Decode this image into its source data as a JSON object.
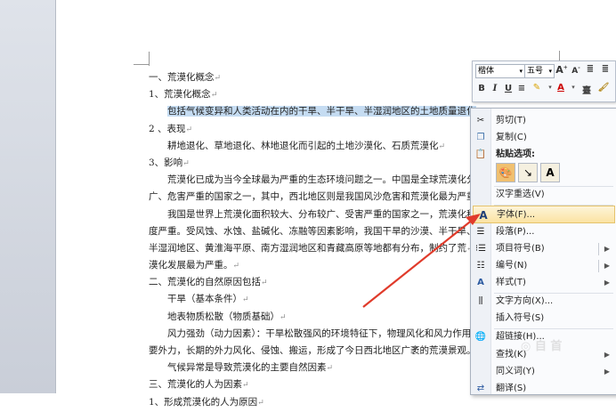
{
  "document": {
    "lines": [
      {
        "text": "一、荒漠化概念"
      },
      {
        "text": "1、荒漠化概念"
      },
      {
        "text": "包括气候变异和人类活动在内的干旱、半干旱、半湿润地区的土地质量退化",
        "highlight": true,
        "indent": true
      },
      {
        "text": "2 、表现"
      },
      {
        "text": "耕地退化、草地退化、林地退化而引起的土地沙漠化、石质荒漠化",
        "indent": true
      },
      {
        "text": "3、影响"
      },
      {
        "text": "荒漠化已成为当今全球最为严重的生态环境问题之一。中国是全球荒漠化分布",
        "indent": true
      },
      {
        "text": "广、危害严重的国家之一，其中，西北地区则是我国风沙危害和荒漠化最为严重的地区。"
      },
      {
        "text": "我国是世界上荒漠化面积较大、分布较广、受害严重的国家之一，荒漠化程",
        "indent": true
      },
      {
        "text": "度严重。受风蚀、水蚀、盐碱化、冻融等因素影响，我国干旱的沙漠、半干旱、"
      },
      {
        "text": "半湿润地区、黄淮海平原、南方湿润地区和青藏高原等地都有分布，制约了荒"
      },
      {
        "text": "漠化发展最为严重。"
      },
      {
        "text": "二、荒漠化的自然原因包括"
      },
      {
        "text": "干旱（基本条件）",
        "indent": true
      },
      {
        "text": "地表物质松散（物质基础）",
        "indent": true
      },
      {
        "text": "风力强劲（动力因素）：干旱松散强风的环境特征下，物理风化和风力作用主",
        "indent": true
      },
      {
        "text": "要外力，长期的外力风化、侵蚀、搬运，形成了今日西北地区广袤的荒漠景观。"
      },
      {
        "text": "气候异常是导致荒漠化的主要自然因素",
        "indent": true
      },
      {
        "text": "三、荒漠化的人为因素"
      },
      {
        "text": "1、形成荒漠化的人为原因"
      }
    ]
  },
  "mini_toolbar": {
    "font": "楷体",
    "size": "五号",
    "grow": "A",
    "shrink": "A",
    "bold": "B",
    "italic": "I",
    "underline": "U"
  },
  "context_menu": {
    "items": [
      {
        "label": "剪切(T)",
        "icon": "scissors-icon"
      },
      {
        "label": "复制(C)",
        "icon": "copy-icon"
      },
      {
        "label": "粘贴选项:",
        "icon": "paste-icon"
      },
      {
        "label": "汉字重选(V)",
        "icon": ""
      },
      {
        "label": "字体(F)...",
        "icon": "font-icon"
      },
      {
        "label": "段落(P)...",
        "icon": "paragraph-icon"
      },
      {
        "label": "项目符号(B)",
        "icon": "bullets-icon",
        "submenu": true
      },
      {
        "label": "编号(N)",
        "icon": "numbering-icon",
        "submenu": true
      },
      {
        "label": "样式(T)",
        "icon": "styles-icon",
        "submenu": true
      },
      {
        "label": "文字方向(X)...",
        "icon": "text-direction-icon"
      },
      {
        "label": "插入符号(S)",
        "icon": ""
      },
      {
        "label": "超链接(H)...",
        "icon": "hyperlink-icon"
      },
      {
        "label": "查找(K)",
        "icon": "",
        "submenu": true
      },
      {
        "label": "同义词(Y)",
        "icon": "",
        "submenu": true
      },
      {
        "label": "翻译(S)",
        "icon": "translate-icon"
      }
    ]
  },
  "colors": {
    "highlight": "#c5dcf2",
    "menu_hover": "#fbe3a2",
    "arrow": "#e03b2b"
  }
}
